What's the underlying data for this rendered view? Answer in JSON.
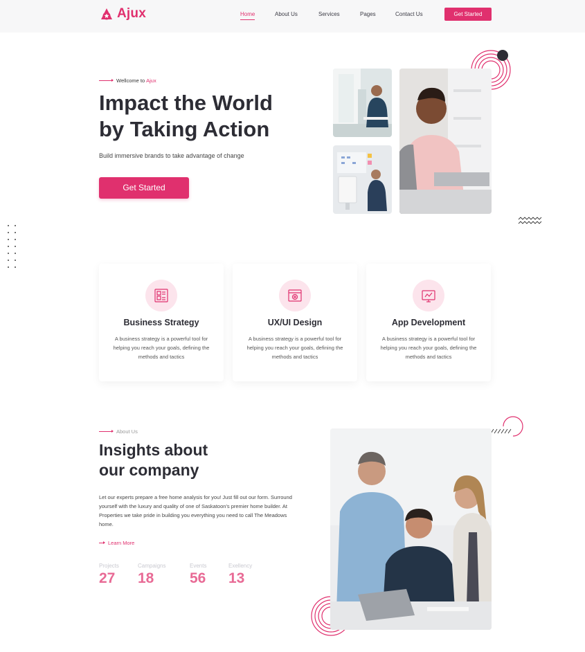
{
  "brand": {
    "name": "Ajux",
    "color": "#e0306e"
  },
  "nav": {
    "items": [
      {
        "label": "Home",
        "active": true
      },
      {
        "label": "About Us",
        "active": false
      },
      {
        "label": "Services",
        "active": false
      },
      {
        "label": "Pages",
        "active": false
      },
      {
        "label": "Contact Us",
        "active": false
      }
    ],
    "cta_label": "Get Started"
  },
  "hero": {
    "eyebrow_prefix": "Wellcome to",
    "eyebrow_brand": "Ajux",
    "title_line1": "Impact the World",
    "title_line2": "by Taking Action",
    "subtitle": "Build immersive brands to take advantage of change",
    "cta_label": "Get Started"
  },
  "services": [
    {
      "icon": "strategy-board-icon",
      "title": "Business Strategy",
      "text": "A business strategy is a powerful tool for helping you reach your goals, defining the methods and tactics"
    },
    {
      "icon": "design-window-icon",
      "title": "UX/UI Design",
      "text": "A business strategy is a powerful tool for helping you reach your goals, defining the methods and tactics"
    },
    {
      "icon": "app-monitor-icon",
      "title": "App Development",
      "text": "A business strategy is a powerful tool for helping you reach your goals, defining the methods and tactics"
    }
  ],
  "about": {
    "eyebrow": "About Us",
    "title_line1": "Insights about",
    "title_line2": "our company",
    "text": "Let our experts prepare a free home analysis for you! Just fill out our form. Surround yourself with the luxury and quality of one of Saskatoon's premier home builder. At Properties we take pride in building you everything you need to call The Meadows home.",
    "link_label": "Learn More",
    "stats": [
      {
        "label": "Projects",
        "value": "27"
      },
      {
        "label": "Campaigns",
        "value": "18"
      },
      {
        "label": "Events",
        "value": "56"
      },
      {
        "label": "Exellency",
        "value": "13"
      }
    ]
  }
}
